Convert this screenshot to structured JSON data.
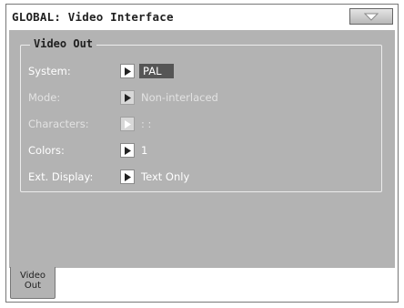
{
  "window": {
    "title": "GLOBAL: Video Interface",
    "menu_icon": "triangle-down-icon"
  },
  "group": {
    "title": "Video Out"
  },
  "params": [
    {
      "label": "System:",
      "value": "PAL",
      "selected": true,
      "enabled": true
    },
    {
      "label": "Mode:",
      "value": "Non-interlaced",
      "selected": false,
      "enabled": false
    },
    {
      "label": "Characters:",
      "value": ": :",
      "selected": false,
      "enabled": false
    },
    {
      "label": "Colors:",
      "value": "1",
      "selected": false,
      "enabled": true
    },
    {
      "label": "Ext. Display:",
      "value": "Text Only",
      "selected": false,
      "enabled": true
    }
  ],
  "tabs": [
    {
      "label": "Video\nOut",
      "active": true
    }
  ],
  "colors": {
    "panel_background": "#b3b3b3",
    "selected_value_background": "#555555",
    "label_text": "#ffffff",
    "disabled_text": "#e2e2e2"
  }
}
